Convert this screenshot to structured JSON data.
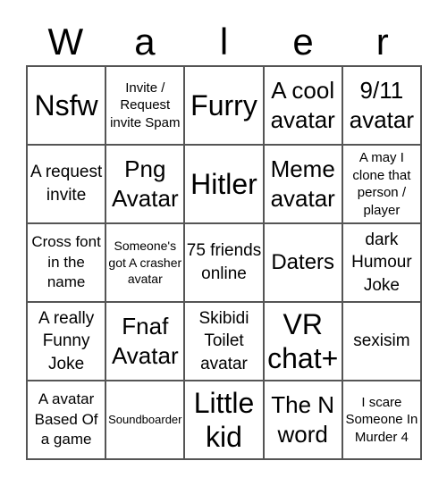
{
  "title_letters": [
    "W",
    "a",
    "l",
    "e",
    "r"
  ],
  "cells": [
    {
      "text": "Nsfw",
      "size": "xl"
    },
    {
      "text": "Invite / Request invite Spam",
      "size": "s"
    },
    {
      "text": "Furry",
      "size": "xl"
    },
    {
      "text": "A cool avatar",
      "size": "l"
    },
    {
      "text": "9/11 avatar",
      "size": "l"
    },
    {
      "text": "A request invite",
      "size": "m"
    },
    {
      "text": "Png Avatar",
      "size": "l"
    },
    {
      "text": "Hitler",
      "size": "xl"
    },
    {
      "text": "Meme avatar",
      "size": "l"
    },
    {
      "text": "A may I clone that person / player",
      "size": "s"
    },
    {
      "text": "Cross font in the name",
      "size": "sm"
    },
    {
      "text": "Someone's got A crasher avatar",
      "size": "xs"
    },
    {
      "text": "75 friends online",
      "size": "m"
    },
    {
      "text": "Daters",
      "size": "m2"
    },
    {
      "text": "dark Humour Joke",
      "size": "m"
    },
    {
      "text": "A really Funny Joke",
      "size": "m"
    },
    {
      "text": "Fnaf Avatar",
      "size": "l"
    },
    {
      "text": "Skibidi Toilet avatar",
      "size": "m"
    },
    {
      "text": "VR chat+",
      "size": "xl"
    },
    {
      "text": "sexisim",
      "size": "m"
    },
    {
      "text": "A avatar Based Of a game",
      "size": "sm"
    },
    {
      "text": "Soundboarder",
      "size": "xxs"
    },
    {
      "text": "Little kid",
      "size": "xl"
    },
    {
      "text": "The N word",
      "size": "l"
    },
    {
      "text": "I scare Someone In Murder 4",
      "size": "s"
    }
  ]
}
